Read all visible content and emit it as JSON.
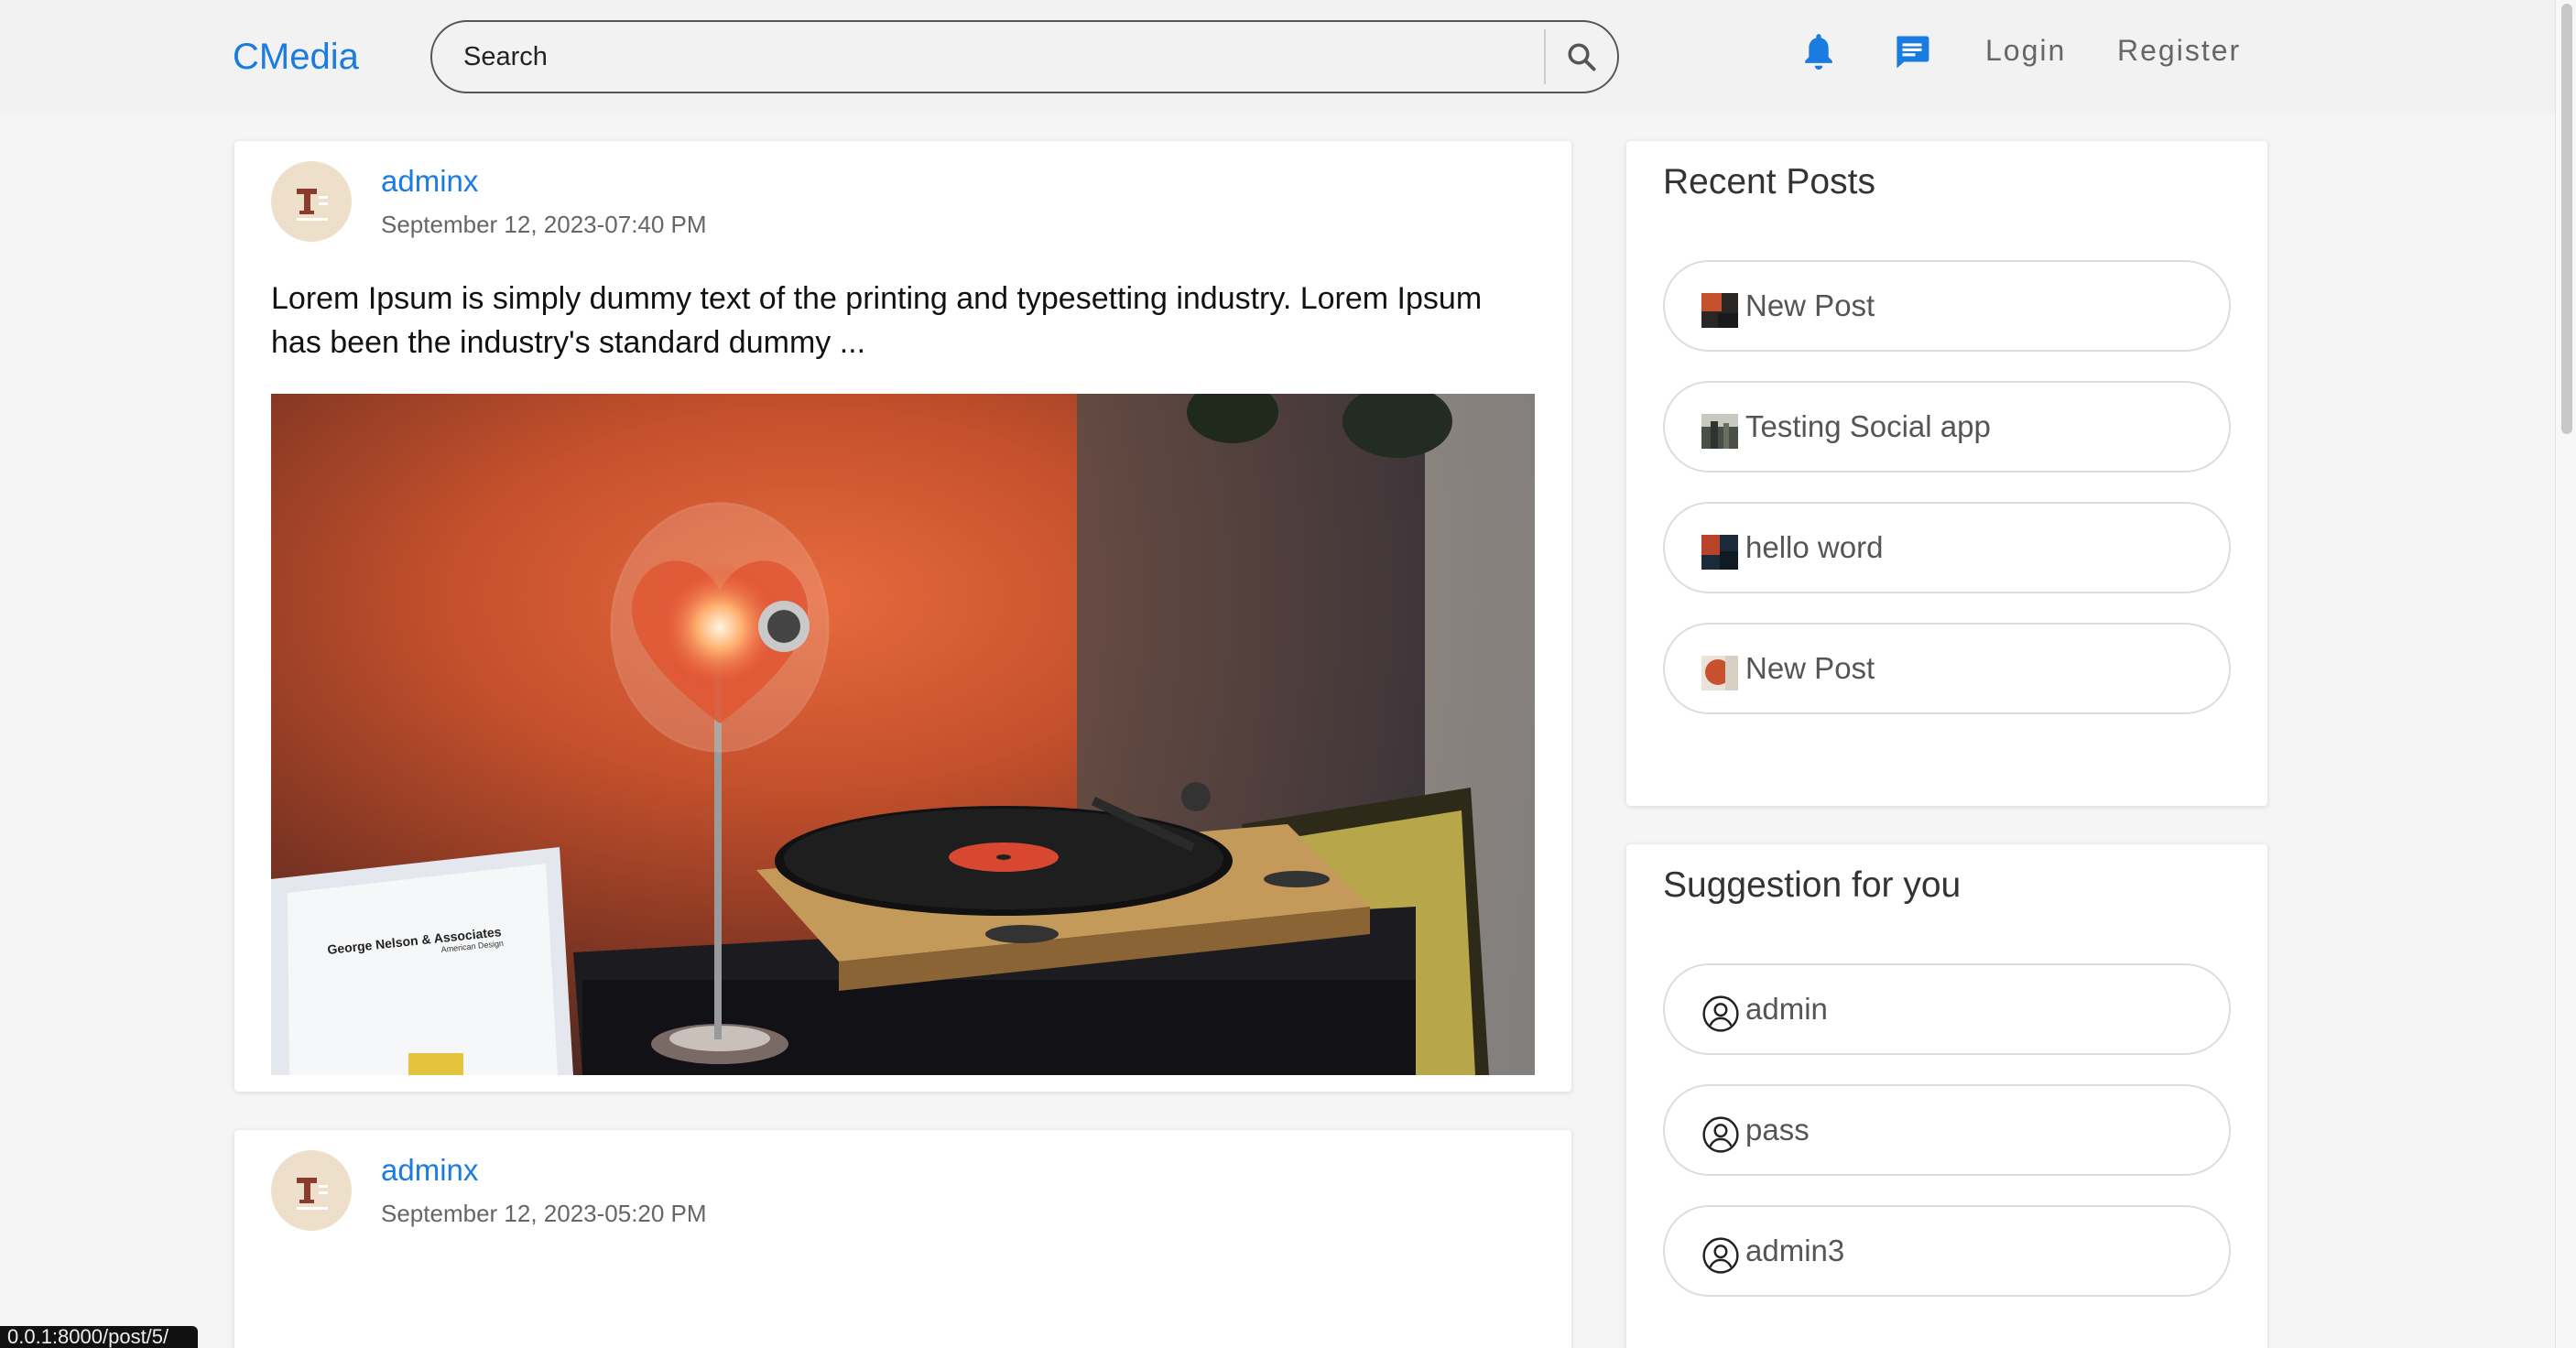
{
  "navbar": {
    "brand": "CMedia",
    "search_placeholder": "Search",
    "login": "Login",
    "register": "Register",
    "accent": "#1a7be0"
  },
  "posts": [
    {
      "user": "adminx",
      "date": "September 12, 2023-07:40 PM",
      "text": "Lorem Ipsum is simply dummy text of the printing and typesetting industry. Lorem Ipsum has been the industry's standard dummy ...",
      "image_label": "George Nelson & Associates",
      "image_sublabel": "American Design"
    },
    {
      "user": "adminx",
      "date": "September 12, 2023-05:20 PM"
    }
  ],
  "recent_posts": {
    "title": "Recent Posts",
    "items": [
      {
        "label": "New Post"
      },
      {
        "label": "Testing Social app"
      },
      {
        "label": "hello word"
      },
      {
        "label": "New Post"
      }
    ]
  },
  "suggestions": {
    "title": "Suggestion for you",
    "items": [
      {
        "label": "admin"
      },
      {
        "label": "pass"
      },
      {
        "label": "admin3"
      }
    ]
  },
  "statusbar": {
    "url": "0.0.1:8000/post/5/"
  }
}
